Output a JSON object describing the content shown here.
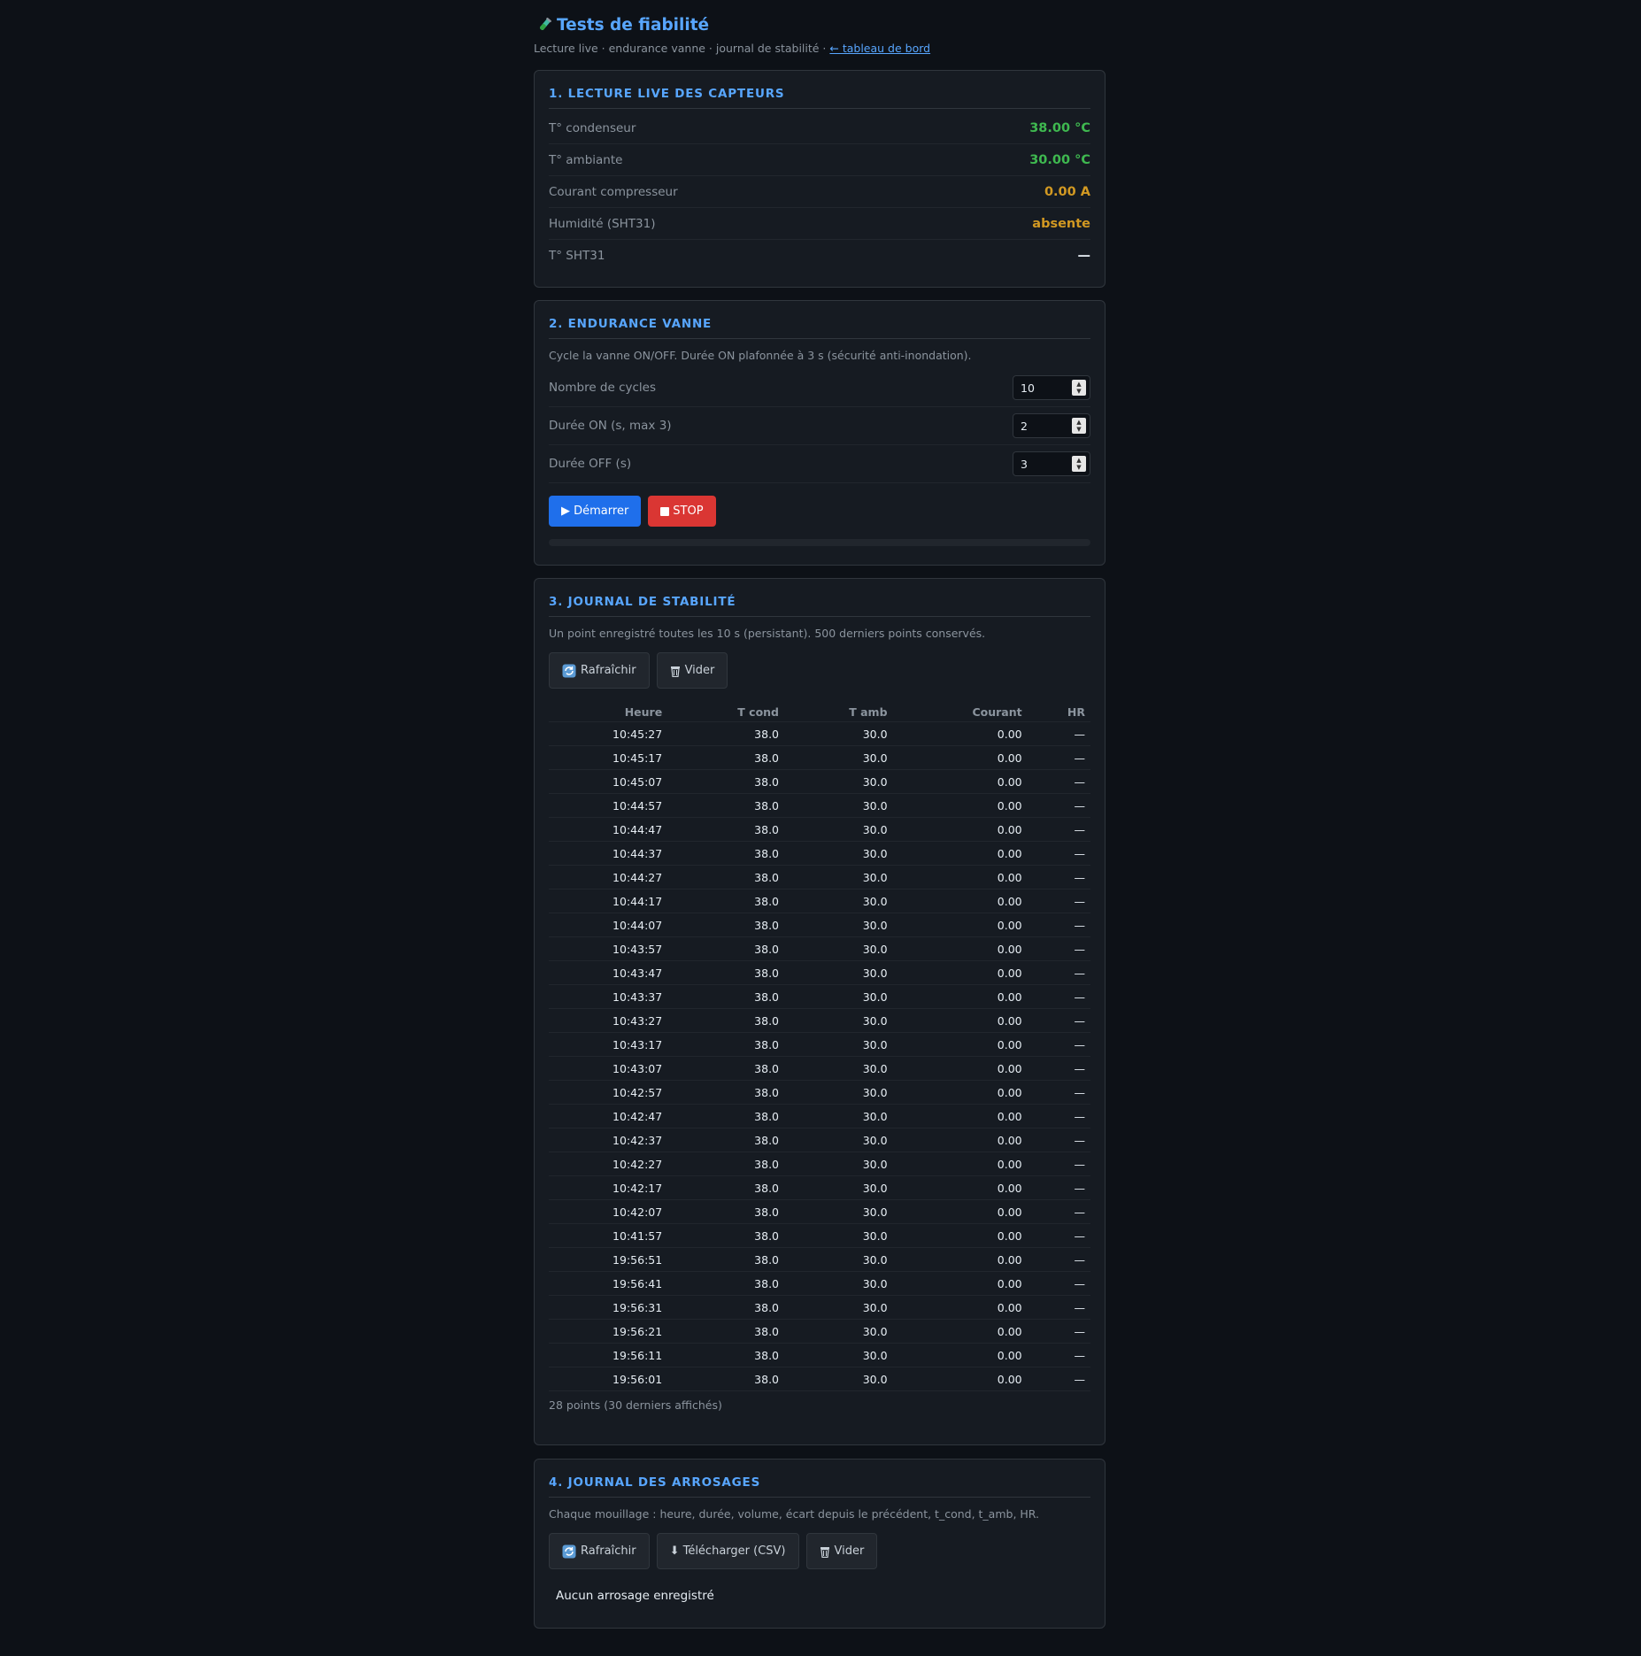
{
  "header": {
    "title": "Tests de fiabilité",
    "subtitle_text": "Lecture live · endurance vanne · journal de stabilité · ",
    "dashboard_link": "← tableau de bord"
  },
  "sensors": {
    "heading": "1. LECTURE LIVE DES CAPTEURS",
    "rows": [
      {
        "label": "T° condenseur",
        "value": "38.00 °C",
        "color": "#3fb950"
      },
      {
        "label": "T° ambiante",
        "value": "30.00 °C",
        "color": "#3fb950"
      },
      {
        "label": "Courant compresseur",
        "value": "0.00 A",
        "color": "#d29922"
      },
      {
        "label": "Humidité (SHT31)",
        "value": "absente",
        "color": "#d29922"
      },
      {
        "label": "T° SHT31",
        "value": "—",
        "color": "#e6edf3"
      }
    ]
  },
  "endurance": {
    "heading": "2. ENDURANCE VANNE",
    "description": "Cycle la vanne ON/OFF. Durée ON plafonnée à 3 s (sécurité anti-inondation).",
    "params": [
      {
        "label": "Nombre de cycles",
        "value": "10"
      },
      {
        "label": "Durée ON (s, max 3)",
        "value": "2"
      },
      {
        "label": "Durée OFF (s)",
        "value": "3"
      }
    ],
    "start_label": "▶ Démarrer",
    "stop_label": "STOP",
    "progress": 0
  },
  "stability": {
    "heading": "3. JOURNAL DE STABILITÉ",
    "description": "Un point enregistré toutes les 10 s (persistant). 500 derniers points conservés.",
    "refresh_label": "Rafraîchir",
    "clear_label": "Vider",
    "columns": [
      "Heure",
      "T cond",
      "T amb",
      "Courant",
      "HR"
    ],
    "rows": [
      [
        "10:45:27",
        "38.0",
        "30.0",
        "0.00",
        "—"
      ],
      [
        "10:45:17",
        "38.0",
        "30.0",
        "0.00",
        "—"
      ],
      [
        "10:45:07",
        "38.0",
        "30.0",
        "0.00",
        "—"
      ],
      [
        "10:44:57",
        "38.0",
        "30.0",
        "0.00",
        "—"
      ],
      [
        "10:44:47",
        "38.0",
        "30.0",
        "0.00",
        "—"
      ],
      [
        "10:44:37",
        "38.0",
        "30.0",
        "0.00",
        "—"
      ],
      [
        "10:44:27",
        "38.0",
        "30.0",
        "0.00",
        "—"
      ],
      [
        "10:44:17",
        "38.0",
        "30.0",
        "0.00",
        "—"
      ],
      [
        "10:44:07",
        "38.0",
        "30.0",
        "0.00",
        "—"
      ],
      [
        "10:43:57",
        "38.0",
        "30.0",
        "0.00",
        "—"
      ],
      [
        "10:43:47",
        "38.0",
        "30.0",
        "0.00",
        "—"
      ],
      [
        "10:43:37",
        "38.0",
        "30.0",
        "0.00",
        "—"
      ],
      [
        "10:43:27",
        "38.0",
        "30.0",
        "0.00",
        "—"
      ],
      [
        "10:43:17",
        "38.0",
        "30.0",
        "0.00",
        "—"
      ],
      [
        "10:43:07",
        "38.0",
        "30.0",
        "0.00",
        "—"
      ],
      [
        "10:42:57",
        "38.0",
        "30.0",
        "0.00",
        "—"
      ],
      [
        "10:42:47",
        "38.0",
        "30.0",
        "0.00",
        "—"
      ],
      [
        "10:42:37",
        "38.0",
        "30.0",
        "0.00",
        "—"
      ],
      [
        "10:42:27",
        "38.0",
        "30.0",
        "0.00",
        "—"
      ],
      [
        "10:42:17",
        "38.0",
        "30.0",
        "0.00",
        "—"
      ],
      [
        "10:42:07",
        "38.0",
        "30.0",
        "0.00",
        "—"
      ],
      [
        "10:41:57",
        "38.0",
        "30.0",
        "0.00",
        "—"
      ],
      [
        "19:56:51",
        "38.0",
        "30.0",
        "0.00",
        "—"
      ],
      [
        "19:56:41",
        "38.0",
        "30.0",
        "0.00",
        "—"
      ],
      [
        "19:56:31",
        "38.0",
        "30.0",
        "0.00",
        "—"
      ],
      [
        "19:56:21",
        "38.0",
        "30.0",
        "0.00",
        "—"
      ],
      [
        "19:56:11",
        "38.0",
        "30.0",
        "0.00",
        "—"
      ],
      [
        "19:56:01",
        "38.0",
        "30.0",
        "0.00",
        "—"
      ]
    ],
    "footer": "28 points (30 derniers affichés)"
  },
  "watering": {
    "heading": "4. JOURNAL DES ARROSAGES",
    "description": "Chaque mouillage : heure, durée, volume, écart depuis le précédent, t_cond, t_amb, HR.",
    "refresh_label": "Rafraîchir",
    "download_label": "⬇ Télécharger (CSV)",
    "clear_label": "Vider",
    "empty_text": "Aucun arrosage enregistré"
  },
  "icons": {
    "title": "flask-icon",
    "refresh": "refresh-icon",
    "trash": "trash-icon",
    "stop": "stop-icon"
  }
}
